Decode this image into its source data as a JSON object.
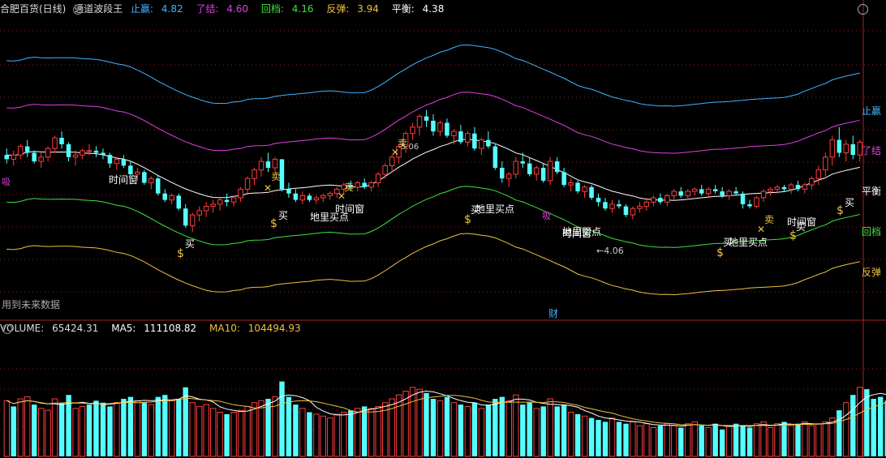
{
  "header": {
    "stock_title": "合肥百货(日线)",
    "indicator_name": "通道波段王",
    "items": [
      {
        "label": "止赢:",
        "value": "4.82",
        "color": "#3fb4ff"
      },
      {
        "label": "了结:",
        "value": "4.60",
        "color": "#e040e0"
      },
      {
        "label": "回档:",
        "value": "4.16",
        "color": "#40e040"
      },
      {
        "label": "反弹:",
        "value": "3.94",
        "color": "#f0c040"
      },
      {
        "label": "平衡:",
        "value": "4.38",
        "color": "#ffffff"
      }
    ]
  },
  "line_labels": {
    "stop_profit": "止赢",
    "close_out": "了结",
    "pullback": "回档",
    "rebound": "反弹",
    "balance": "平衡"
  },
  "annotations": {
    "buy": "买",
    "sell": "卖",
    "time_window": "时间窗",
    "bottom_buy": "地里买点",
    "bottom_buy_2": "地里买点",
    "low_price": "4.06",
    "high_price": "5.06",
    "future_data": "用到未来数据",
    "finance": "财",
    "left_edge": "吸",
    "mid_mark": "吸"
  },
  "volume": {
    "title": "VOLUME:",
    "value": "65424.31",
    "ma5_label": "MA5:",
    "ma5_value": "111108.82",
    "ma10_label": "MA10:",
    "ma10_value": "104494.93"
  },
  "colors": {
    "up": "#ff3c3c",
    "down": "#54ffff",
    "stop_profit": "#3fb4ff",
    "close_out": "#e040e0",
    "pullback": "#40e040",
    "rebound": "#f0c040",
    "balance": "#ffffff",
    "grid": "#8a1c1c"
  },
  "chart_data": {
    "type": "candlestick",
    "candles": [
      [
        4.31,
        4.34,
        4.27,
        4.29
      ],
      [
        4.29,
        4.33,
        4.26,
        4.31
      ],
      [
        4.31,
        4.36,
        4.29,
        4.35
      ],
      [
        4.35,
        4.38,
        4.3,
        4.32
      ],
      [
        4.32,
        4.33,
        4.27,
        4.28
      ],
      [
        4.28,
        4.32,
        4.25,
        4.3
      ],
      [
        4.3,
        4.35,
        4.28,
        4.34
      ],
      [
        4.34,
        4.4,
        4.32,
        4.39
      ],
      [
        4.39,
        4.42,
        4.34,
        4.36
      ],
      [
        4.36,
        4.37,
        4.28,
        4.3
      ],
      [
        4.3,
        4.33,
        4.26,
        4.31
      ],
      [
        4.31,
        4.34,
        4.29,
        4.33
      ],
      [
        4.33,
        4.36,
        4.31,
        4.33
      ],
      [
        4.33,
        4.35,
        4.3,
        4.32
      ],
      [
        4.32,
        4.34,
        4.29,
        4.31
      ],
      [
        4.31,
        4.32,
        4.25,
        4.27
      ],
      [
        4.27,
        4.3,
        4.24,
        4.29
      ],
      [
        4.29,
        4.31,
        4.25,
        4.26
      ],
      [
        4.26,
        4.28,
        4.21,
        4.22
      ],
      [
        4.22,
        4.25,
        4.19,
        4.23
      ],
      [
        4.23,
        4.24,
        4.17,
        4.18
      ],
      [
        4.18,
        4.21,
        4.15,
        4.2
      ],
      [
        4.2,
        4.21,
        4.12,
        4.13
      ],
      [
        4.13,
        4.15,
        4.09,
        4.1
      ],
      [
        4.1,
        4.13,
        4.08,
        4.12
      ],
      [
        4.12,
        4.13,
        4.05,
        4.06
      ],
      [
        4.06,
        4.08,
        3.97,
        3.98
      ],
      [
        3.98,
        4.04,
        3.95,
        4.03
      ],
      [
        4.03,
        4.07,
        4.0,
        4.05
      ],
      [
        4.05,
        4.09,
        4.02,
        4.07
      ],
      [
        4.07,
        4.1,
        4.04,
        4.08
      ],
      [
        4.08,
        4.11,
        4.05,
        4.1
      ],
      [
        4.1,
        4.13,
        4.07,
        4.09
      ],
      [
        4.09,
        4.12,
        4.07,
        4.11
      ],
      [
        4.11,
        4.16,
        4.09,
        4.15
      ],
      [
        4.15,
        4.21,
        4.13,
        4.2
      ],
      [
        4.2,
        4.25,
        4.17,
        4.24
      ],
      [
        4.24,
        4.3,
        4.21,
        4.28
      ],
      [
        4.28,
        4.32,
        4.23,
        4.25
      ],
      [
        4.25,
        4.3,
        4.23,
        4.29
      ],
      [
        4.29,
        4.29,
        4.14,
        4.15
      ],
      [
        4.15,
        4.18,
        4.11,
        4.13
      ],
      [
        4.13,
        4.15,
        4.09,
        4.1
      ],
      [
        4.1,
        4.14,
        4.08,
        4.12
      ],
      [
        4.12,
        4.13,
        4.09,
        4.1
      ],
      [
        4.1,
        4.12,
        4.08,
        4.11
      ],
      [
        4.11,
        4.13,
        4.09,
        4.12
      ],
      [
        4.12,
        4.14,
        4.1,
        4.13
      ],
      [
        4.13,
        4.16,
        4.11,
        4.15
      ],
      [
        4.15,
        4.18,
        4.13,
        4.17
      ],
      [
        4.17,
        4.19,
        4.14,
        4.16
      ],
      [
        4.16,
        4.19,
        4.14,
        4.18
      ],
      [
        4.18,
        4.2,
        4.15,
        4.16
      ],
      [
        4.16,
        4.19,
        4.14,
        4.18
      ],
      [
        4.18,
        4.23,
        4.16,
        4.22
      ],
      [
        4.22,
        4.27,
        4.2,
        4.26
      ],
      [
        4.26,
        4.31,
        4.23,
        4.3
      ],
      [
        4.3,
        4.36,
        4.27,
        4.35
      ],
      [
        4.35,
        4.42,
        4.32,
        4.41
      ],
      [
        4.41,
        4.46,
        4.38,
        4.44
      ],
      [
        4.44,
        4.5,
        4.4,
        4.49
      ],
      [
        4.49,
        4.52,
        4.44,
        4.47
      ],
      [
        4.47,
        4.5,
        4.4,
        4.42
      ],
      [
        4.42,
        4.47,
        4.4,
        4.46
      ],
      [
        4.46,
        4.48,
        4.39,
        4.4
      ],
      [
        4.4,
        4.43,
        4.36,
        4.42
      ],
      [
        4.42,
        4.45,
        4.36,
        4.37
      ],
      [
        4.37,
        4.42,
        4.35,
        4.41
      ],
      [
        4.41,
        4.44,
        4.33,
        4.34
      ],
      [
        4.34,
        4.39,
        4.31,
        4.38
      ],
      [
        4.38,
        4.42,
        4.34,
        4.35
      ],
      [
        4.35,
        4.36,
        4.24,
        4.25
      ],
      [
        4.25,
        4.28,
        4.18,
        4.2
      ],
      [
        4.2,
        4.23,
        4.16,
        4.22
      ],
      [
        4.22,
        4.3,
        4.2,
        4.28
      ],
      [
        4.28,
        4.32,
        4.25,
        4.27
      ],
      [
        4.27,
        4.3,
        4.21,
        4.22
      ],
      [
        4.22,
        4.26,
        4.19,
        4.25
      ],
      [
        4.25,
        4.27,
        4.18,
        4.19
      ],
      [
        4.19,
        4.3,
        4.17,
        4.28
      ],
      [
        4.28,
        4.3,
        4.22,
        4.23
      ],
      [
        4.23,
        4.25,
        4.16,
        4.17
      ],
      [
        4.17,
        4.2,
        4.14,
        4.18
      ],
      [
        4.18,
        4.19,
        4.13,
        4.14
      ],
      [
        4.14,
        4.17,
        4.11,
        4.16
      ],
      [
        4.16,
        4.17,
        4.1,
        4.11
      ],
      [
        4.11,
        4.13,
        4.07,
        4.09
      ],
      [
        4.09,
        4.11,
        4.05,
        4.06
      ],
      [
        4.06,
        4.1,
        4.04,
        4.08
      ],
      [
        4.08,
        4.1,
        4.06,
        4.07
      ],
      [
        4.07,
        4.08,
        4.02,
        4.03
      ],
      [
        4.03,
        4.07,
        4.01,
        4.06
      ],
      [
        4.06,
        4.09,
        4.04,
        4.07
      ],
      [
        4.07,
        4.1,
        4.05,
        4.09
      ],
      [
        4.09,
        4.12,
        4.07,
        4.11
      ],
      [
        4.11,
        4.13,
        4.08,
        4.09
      ],
      [
        4.09,
        4.13,
        4.07,
        4.12
      ],
      [
        4.12,
        4.15,
        4.1,
        4.14
      ],
      [
        4.14,
        4.16,
        4.11,
        4.12
      ],
      [
        4.12,
        4.15,
        4.1,
        4.14
      ],
      [
        4.14,
        4.16,
        4.12,
        4.15
      ],
      [
        4.15,
        4.17,
        4.12,
        4.13
      ],
      [
        4.13,
        4.16,
        4.11,
        4.15
      ],
      [
        4.15,
        4.17,
        4.13,
        4.14
      ],
      [
        4.14,
        4.16,
        4.11,
        4.12
      ],
      [
        4.12,
        4.15,
        4.1,
        4.14
      ],
      [
        4.14,
        4.16,
        4.12,
        4.13
      ],
      [
        4.13,
        4.14,
        4.06,
        4.08
      ],
      [
        4.08,
        4.1,
        4.06,
        4.07
      ],
      [
        4.07,
        4.12,
        4.06,
        4.11
      ],
      [
        4.11,
        4.15,
        4.09,
        4.14
      ],
      [
        4.14,
        4.16,
        4.12,
        4.15
      ],
      [
        4.15,
        4.17,
        4.13,
        4.16
      ],
      [
        4.16,
        4.17,
        4.14,
        4.15
      ],
      [
        4.15,
        4.18,
        4.13,
        4.17
      ],
      [
        4.17,
        4.19,
        4.14,
        4.15
      ],
      [
        4.15,
        4.18,
        4.13,
        4.17
      ],
      [
        4.17,
        4.21,
        4.15,
        4.2
      ],
      [
        4.2,
        4.26,
        4.17,
        4.24
      ],
      [
        4.24,
        4.32,
        4.21,
        4.3
      ],
      [
        4.3,
        4.4,
        4.26,
        4.38
      ],
      [
        4.38,
        4.44,
        4.3,
        4.32
      ],
      [
        4.32,
        4.38,
        4.28,
        4.36
      ],
      [
        4.36,
        4.4,
        4.29,
        4.31
      ],
      [
        4.31,
        4.38,
        4.28,
        4.37
      ]
    ],
    "volumes": [
      58,
      52,
      60,
      62,
      54,
      50,
      48,
      60,
      56,
      64,
      50,
      52,
      54,
      58,
      56,
      52,
      56,
      60,
      62,
      58,
      56,
      54,
      62,
      64,
      58,
      60,
      72,
      56,
      52,
      54,
      50,
      46,
      44,
      46,
      48,
      52,
      56,
      58,
      60,
      62,
      78,
      62,
      54,
      50,
      46,
      44,
      42,
      40,
      44,
      46,
      48,
      50,
      52,
      50,
      52,
      56,
      60,
      64,
      68,
      72,
      70,
      66,
      60,
      58,
      62,
      56,
      54,
      52,
      56,
      50,
      54,
      60,
      62,
      58,
      64,
      54,
      56,
      50,
      52,
      60,
      52,
      54,
      46,
      44,
      42,
      40,
      38,
      36,
      40,
      36,
      34,
      36,
      32,
      34,
      30,
      32,
      34,
      32,
      30,
      34,
      36,
      32,
      30,
      34,
      28,
      32,
      34,
      32,
      30,
      34,
      36,
      30,
      34,
      36,
      32,
      34,
      36,
      32,
      34,
      36,
      40,
      48,
      56,
      64,
      72,
      70,
      60,
      62,
      58
    ],
    "volume_up_flags": [
      1,
      0,
      1,
      1,
      0,
      1,
      1,
      1,
      0,
      0,
      1,
      1,
      0,
      0,
      0,
      0,
      1,
      0,
      0,
      1,
      0,
      1,
      0,
      0,
      1,
      0,
      0,
      1,
      1,
      1,
      1,
      1,
      0,
      1,
      1,
      1,
      1,
      1,
      0,
      1,
      0,
      0,
      0,
      1,
      0,
      1,
      1,
      1,
      1,
      1,
      0,
      1,
      0,
      1,
      1,
      1,
      1,
      1,
      1,
      1,
      1,
      0,
      0,
      1,
      0,
      1,
      0,
      1,
      0,
      1,
      0,
      0,
      0,
      1,
      1,
      0,
      0,
      1,
      0,
      1,
      0,
      0,
      1,
      0,
      1,
      0,
      0,
      0,
      1,
      0,
      0,
      1,
      1,
      1,
      1,
      0,
      1,
      1,
      0,
      1,
      1,
      0,
      1,
      0,
      0,
      1,
      0,
      0,
      0,
      1,
      1,
      1,
      1,
      0,
      1,
      0,
      1,
      1,
      1,
      1,
      1,
      0,
      1,
      0,
      1
    ]
  }
}
